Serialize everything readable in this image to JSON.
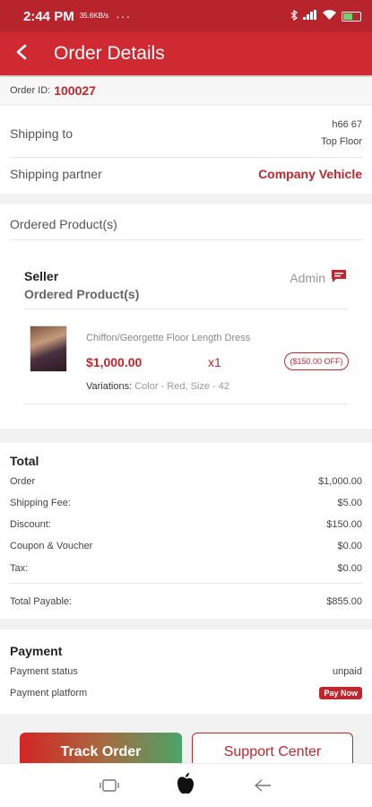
{
  "status_bar": {
    "time": "2:44 PM",
    "speed": "35.6KB/s",
    "dots": "···"
  },
  "header": {
    "title": "Order Details"
  },
  "order": {
    "id_label": "Order ID:",
    "id_value": "100027"
  },
  "shipping": {
    "to_label": "Shipping to",
    "address_line1": "h66 67",
    "address_line2": "Top Floor",
    "partner_label": "Shipping partner",
    "partner_value": "Company Vehicle"
  },
  "products": {
    "heading": "Ordered Product(s)",
    "seller_label": "Seller",
    "seller_sub": "Ordered Product(s)",
    "seller_name": "Admin",
    "items": [
      {
        "name": "Chiffon/Georgette Floor Length Dress",
        "price": "$1,000.00",
        "qty": "x1",
        "discount": "($150.00 OFF)",
        "variations_label": "Variations:",
        "variations_value": "Color - Red,  Size - 42"
      }
    ]
  },
  "summary": {
    "title": "Total",
    "rows": [
      {
        "label": "Order",
        "value": "$1,000.00"
      },
      {
        "label": "Shipping Fee:",
        "value": "$5.00"
      },
      {
        "label": "Discount:",
        "value": "$150.00"
      },
      {
        "label": "Coupon & Voucher",
        "value": "$0.00"
      },
      {
        "label": "Tax:",
        "value": "$0.00"
      }
    ],
    "payable_label": "Total Payable:",
    "payable_value": "$855.00"
  },
  "payment": {
    "title": "Payment",
    "status_label": "Payment status",
    "status_value": "unpaid",
    "platform_label": "Payment platform",
    "pay_now_label": "Pay Now"
  },
  "actions": {
    "track_label": "Track Order",
    "support_label": "Support Center"
  },
  "colors": {
    "brand": "#cf2a31",
    "accent": "#c0272d",
    "track_gradient_end": "#4aa56a"
  },
  "icons": {
    "back": "back-arrow-icon",
    "chat": "chat-icon",
    "nav_recents": "recents-icon",
    "nav_home": "apple-icon",
    "nav_back": "nav-back-icon"
  }
}
